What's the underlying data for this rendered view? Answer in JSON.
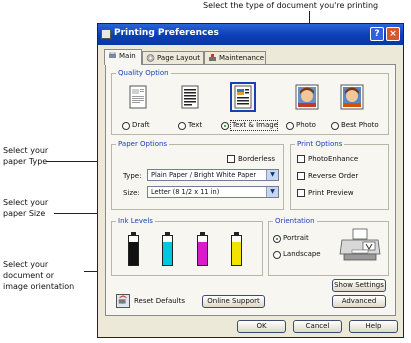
{
  "callouts": {
    "top": "Select the type of document you're printing",
    "paper_type": [
      "Select your",
      "paper Type"
    ],
    "paper_size": [
      "Select your",
      "paper Size"
    ],
    "orientation": [
      "Select your",
      "document or",
      "image orientation"
    ]
  },
  "window": {
    "title": "Printing Preferences",
    "help_glyph": "?",
    "close_glyph": "×"
  },
  "tabs": [
    "Main",
    "Page Layout",
    "Maintenance"
  ],
  "quality": {
    "label": "Quality Option",
    "options": [
      "Draft",
      "Text",
      "Text & Image",
      "Photo",
      "Best Photo"
    ],
    "selected": "Text & Image"
  },
  "paper_options": {
    "label": "Paper Options",
    "borderless": "Borderless",
    "type_label": "Type:",
    "type_value": "Plain Paper / Bright White Paper",
    "size_label": "Size:",
    "size_value": "Letter (8 1/2 x 11 in)"
  },
  "print_options": {
    "label": "Print Options",
    "items": [
      "PhotoEnhance",
      "Reverse Order",
      "Print Preview"
    ]
  },
  "ink_levels": {
    "label": "Ink Levels",
    "colors": [
      "#111111",
      "#00c8e0",
      "#d81ecb",
      "#f2e400"
    ],
    "levels": [
      0.78,
      0.78,
      0.78,
      0.78
    ]
  },
  "orientation": {
    "label": "Orientation",
    "options": [
      "Portrait",
      "Landscape"
    ],
    "selected": "Portrait"
  },
  "buttons": {
    "show_settings": "Show Settings",
    "advanced": "Advanced",
    "reset_defaults": "Reset Defaults",
    "online_support": "Online Support",
    "ok": "OK",
    "cancel": "Cancel",
    "help": "Help"
  }
}
